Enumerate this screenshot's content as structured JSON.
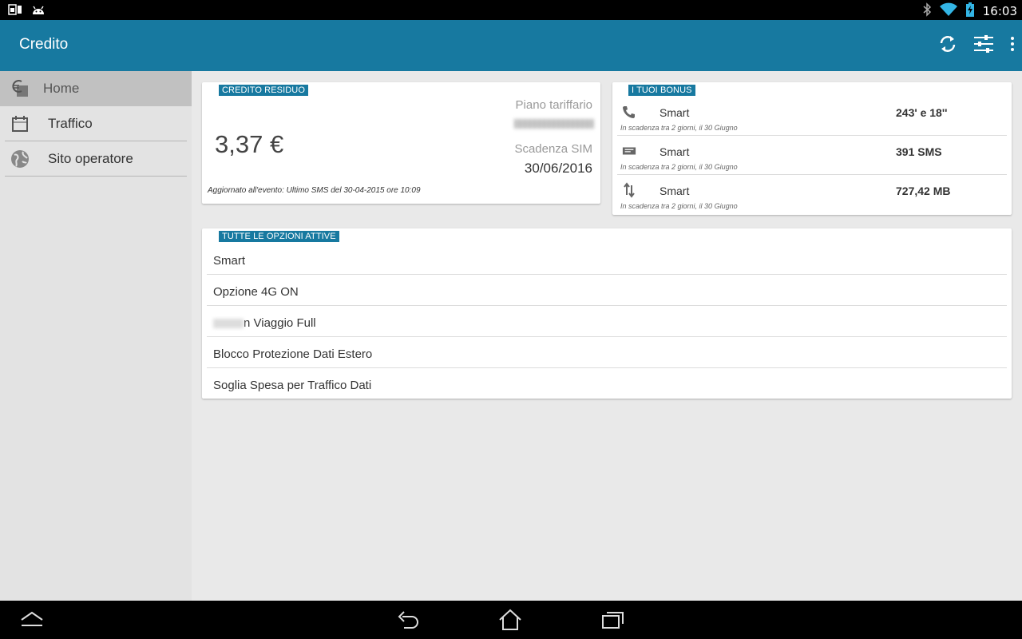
{
  "status_bar": {
    "time": "16:03",
    "left_icons": [
      "sim-icon",
      "android-icon"
    ],
    "right_icons": [
      "bluetooth-icon",
      "wifi-icon",
      "battery-charging-icon"
    ]
  },
  "app_bar": {
    "title": "Credito",
    "actions": [
      "refresh-icon",
      "settings-sliders-icon",
      "overflow-menu-icon"
    ],
    "color": "#1779a0"
  },
  "sidebar": {
    "items": [
      {
        "label": "Home",
        "icon": "euro-icon",
        "active": true
      },
      {
        "label": "Traffico",
        "icon": "calendar-icon",
        "active": false
      },
      {
        "label": "Sito operatore",
        "icon": "globe-icon",
        "active": false
      }
    ]
  },
  "credit": {
    "tag": "CREDITO RESIDUO",
    "amount": "3,37 €",
    "plan_label": "Piano tariffario",
    "expiry_label": "Scadenza SIM",
    "expiry_date": "30/06/2016",
    "updated": "Aggiornato all'evento: Ultimo SMS del 30-04-2015 ore 10:09"
  },
  "bonus": {
    "tag": "I TUOI BONUS",
    "items": [
      {
        "icon": "phone-icon",
        "name": "Smart",
        "value": "243' e 18''",
        "expiry": "In scadenza tra 2 giorni, il 30 Giugno"
      },
      {
        "icon": "sms-icon",
        "name": "Smart",
        "value": "391 SMS",
        "expiry": "In scadenza tra 2 giorni, il 30 Giugno"
      },
      {
        "icon": "data-arrows-icon",
        "name": "Smart",
        "value": "727,42 MB",
        "expiry": "In scadenza tra 2 giorni, il 30 Giugno"
      }
    ]
  },
  "options": {
    "tag": "TUTTE LE OPZIONI ATTIVE",
    "items": [
      "Smart",
      "Opzione 4G ON",
      "n Viaggio Full",
      "Blocco Protezione Dati Estero",
      "Soglia Spesa per Traffico Dati"
    ]
  },
  "nav_bar": {
    "buttons": [
      "collapse-icon",
      "back-icon",
      "home-icon",
      "recents-icon"
    ]
  }
}
